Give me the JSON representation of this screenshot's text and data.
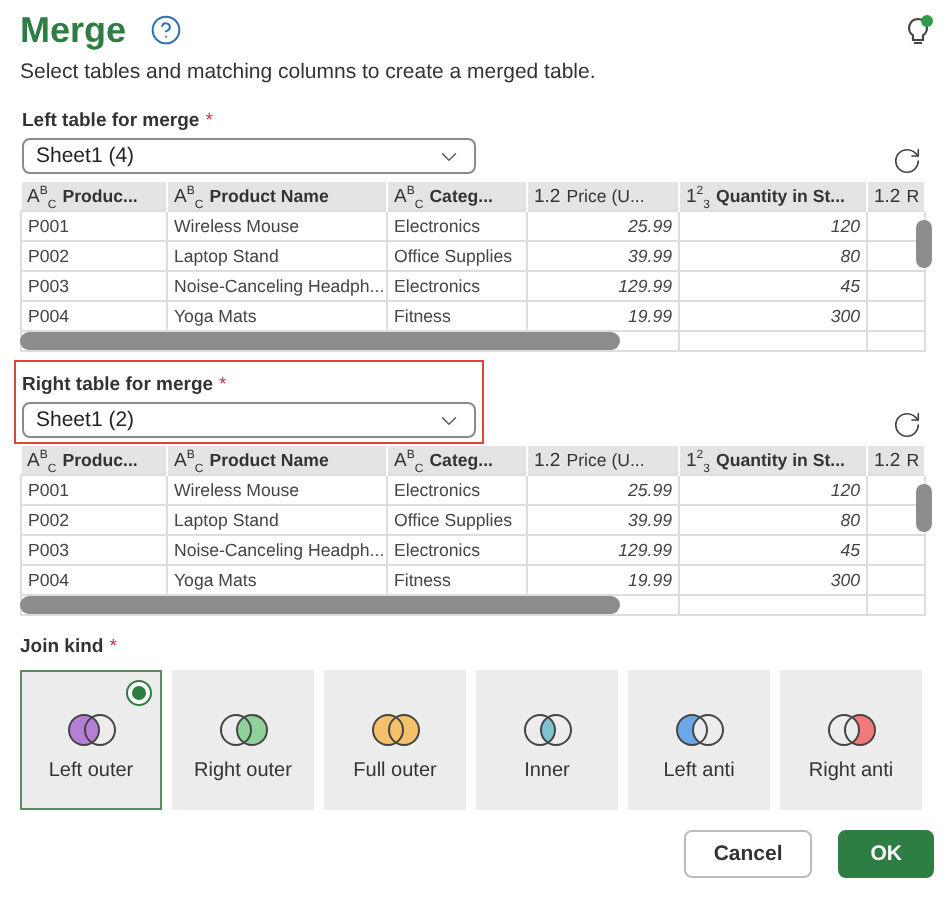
{
  "title": "Merge",
  "description": "Select tables and matching columns to create a merged table.",
  "sections": [
    {
      "label": "Left table for merge",
      "required": "*",
      "value": "Sheet1 (4)",
      "highlighted": false,
      "columns": [
        {
          "type_label": "A$^{B}$$_{C}$",
          "label": "Produc...",
          "kind": "text"
        },
        {
          "type_label": "A$^{B}$$_{C}$",
          "label": "Product Name",
          "kind": "text"
        },
        {
          "type_label": "A$^{B}$$_{C}$",
          "label": "Categ...",
          "kind": "text"
        },
        {
          "type_label": "1.2",
          "label": "Price (U...",
          "kind": "number"
        },
        {
          "type_label": "1$^{2}$$_{3}$",
          "label": "Quantity in St...",
          "kind": "number"
        },
        {
          "type_label": "1.2",
          "label": "R",
          "kind": "number"
        }
      ],
      "rows": [
        [
          "P001",
          "Wireless Mouse",
          "Electronics",
          "25.99",
          "120"
        ],
        [
          "P002",
          "Laptop Stand",
          "Office Supplies",
          "39.99",
          "80"
        ],
        [
          "P003",
          "Noise-Canceling Headph...",
          "Electronics",
          "129.99",
          "45"
        ],
        [
          "P004",
          "Yoga Mats",
          "Fitness",
          "19.99",
          "300"
        ]
      ]
    },
    {
      "label": "Right table for merge",
      "required": "*",
      "value": "Sheet1 (2)",
      "highlighted": true,
      "columns": [
        {
          "type_label": "A$^{B}$$_{C}$",
          "label": "Produc...",
          "kind": "text"
        },
        {
          "type_label": "A$^{B}$$_{C}$",
          "label": "Product Name",
          "kind": "text"
        },
        {
          "type_label": "A$^{B}$$_{C}$",
          "label": "Categ...",
          "kind": "text"
        },
        {
          "type_label": "1.2",
          "label": "Price (U...",
          "kind": "number"
        },
        {
          "type_label": "1$^{2}$$_{3}$",
          "label": "Quantity in St...",
          "kind": "number"
        },
        {
          "type_label": "1.2",
          "label": "R",
          "kind": "number"
        }
      ],
      "rows": [
        [
          "P001",
          "Wireless Mouse",
          "Electronics",
          "25.99",
          "120"
        ],
        [
          "P002",
          "Laptop Stand",
          "Office Supplies",
          "39.99",
          "80"
        ],
        [
          "P003",
          "Noise-Canceling Headph...",
          "Electronics",
          "129.99",
          "45"
        ],
        [
          "P004",
          "Yoga Mats",
          "Fitness",
          "19.99",
          "300"
        ]
      ]
    }
  ],
  "join": {
    "label": "Join kind",
    "required": "*",
    "options": [
      {
        "label": "Left outer",
        "kind": "left",
        "color": "#b67fd6",
        "selected": true
      },
      {
        "label": "Right outer",
        "kind": "right",
        "color": "#8fd19a",
        "selected": false
      },
      {
        "label": "Full outer",
        "kind": "full",
        "color": "#f5c26b",
        "selected": false
      },
      {
        "label": "Inner",
        "kind": "inner",
        "color": "#7ec3cf",
        "selected": false
      },
      {
        "label": "Left anti",
        "kind": "left_anti",
        "color": "#6aa8e8",
        "selected": false
      },
      {
        "label": "Right anti",
        "kind": "right_anti",
        "color": "#f07a7a",
        "selected": false
      }
    ]
  },
  "buttons": [
    {
      "label": "Cancel",
      "kind": "secondary"
    },
    {
      "label": "OK",
      "kind": "primary"
    }
  ]
}
